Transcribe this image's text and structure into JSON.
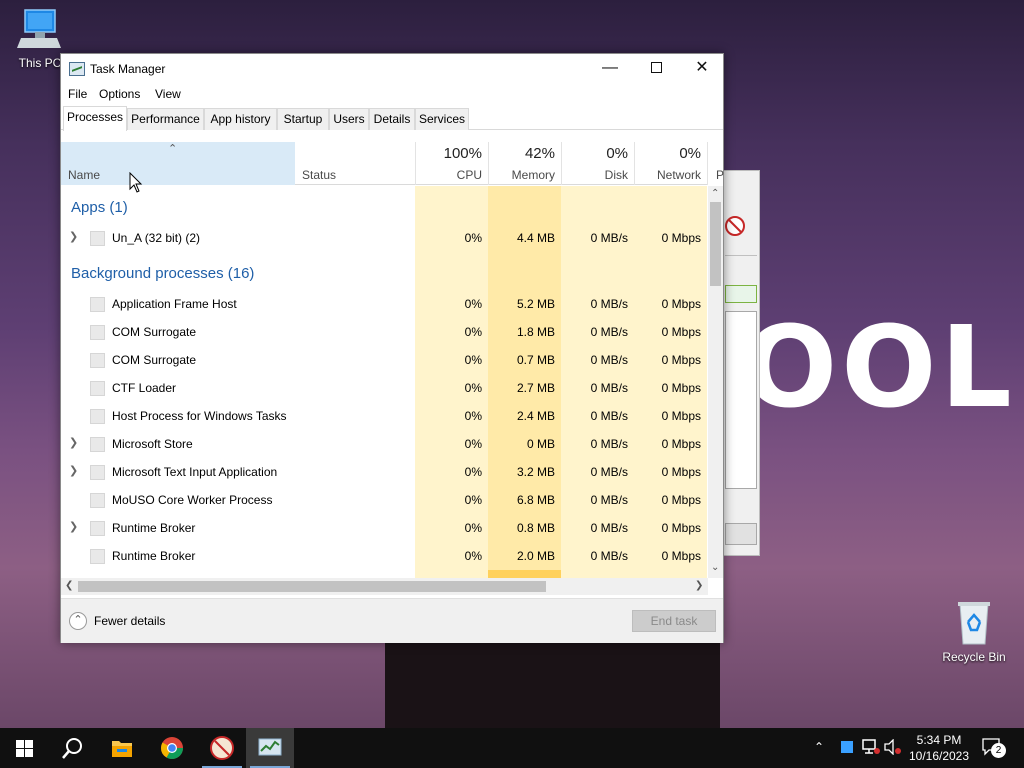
{
  "desktop": {
    "icons": {
      "this_pc": "This PC",
      "recycle_bin": "Recycle Bin"
    },
    "wallpaper_text": "OOL"
  },
  "window": {
    "title": "Task Manager",
    "menu": [
      "File",
      "Options",
      "View"
    ],
    "tabs": [
      "Processes",
      "Performance",
      "App history",
      "Startup",
      "Users",
      "Details",
      "Services"
    ],
    "active_tab": "Processes"
  },
  "columns": {
    "name": "Name",
    "status": "Status",
    "cpu": {
      "percent": "100%",
      "label": "CPU"
    },
    "memory": {
      "percent": "42%",
      "label": "Memory"
    },
    "disk": {
      "percent": "0%",
      "label": "Disk"
    },
    "network": {
      "percent": "0%",
      "label": "Network"
    },
    "power_partial": "P"
  },
  "groups": {
    "apps": "Apps (1)",
    "background": "Background processes (16)"
  },
  "apps": [
    {
      "name": "Un_A (32 bit) (2)",
      "cpu": "0%",
      "memory": "4.4 MB",
      "disk": "0 MB/s",
      "network": "0 Mbps",
      "expandable": true
    }
  ],
  "background": [
    {
      "name": "Application Frame Host",
      "cpu": "0%",
      "memory": "5.2 MB",
      "disk": "0 MB/s",
      "network": "0 Mbps",
      "expandable": false
    },
    {
      "name": "COM Surrogate",
      "cpu": "0%",
      "memory": "1.8 MB",
      "disk": "0 MB/s",
      "network": "0 Mbps",
      "expandable": false
    },
    {
      "name": "COM Surrogate",
      "cpu": "0%",
      "memory": "0.7 MB",
      "disk": "0 MB/s",
      "network": "0 Mbps",
      "expandable": false
    },
    {
      "name": "CTF Loader",
      "cpu": "0%",
      "memory": "2.7 MB",
      "disk": "0 MB/s",
      "network": "0 Mbps",
      "expandable": false
    },
    {
      "name": "Host Process for Windows Tasks",
      "cpu": "0%",
      "memory": "2.4 MB",
      "disk": "0 MB/s",
      "network": "0 Mbps",
      "expandable": false
    },
    {
      "name": "Microsoft Store",
      "cpu": "0%",
      "memory": "0 MB",
      "disk": "0 MB/s",
      "network": "0 Mbps",
      "expandable": true
    },
    {
      "name": "Microsoft Text Input Application",
      "cpu": "0%",
      "memory": "3.2 MB",
      "disk": "0 MB/s",
      "network": "0 Mbps",
      "expandable": true
    },
    {
      "name": "MoUSO Core Worker Process",
      "cpu": "0%",
      "memory": "6.8 MB",
      "disk": "0 MB/s",
      "network": "0 Mbps",
      "expandable": false
    },
    {
      "name": "Runtime Broker",
      "cpu": "0%",
      "memory": "0.8 MB",
      "disk": "0 MB/s",
      "network": "0 Mbps",
      "expandable": true
    },
    {
      "name": "Runtime Broker",
      "cpu": "0%",
      "memory": "2.0 MB",
      "disk": "0 MB/s",
      "network": "0 Mbps",
      "expandable": false
    }
  ],
  "footer": {
    "fewer_details": "Fewer details",
    "end_task": "End task"
  },
  "taskbar": {
    "time": "5:34 PM",
    "date": "10/16/2023",
    "notification_count": "2",
    "apps": [
      "start",
      "search",
      "file-explorer",
      "chrome",
      "un-a-app",
      "task-manager"
    ],
    "active_app": "task-manager"
  },
  "colors": {
    "accent": "#1f5fa8",
    "cpu_shade": "#fff4cc",
    "mem_shade": "#ffeaa8",
    "name_header": "#d9eaf7"
  }
}
